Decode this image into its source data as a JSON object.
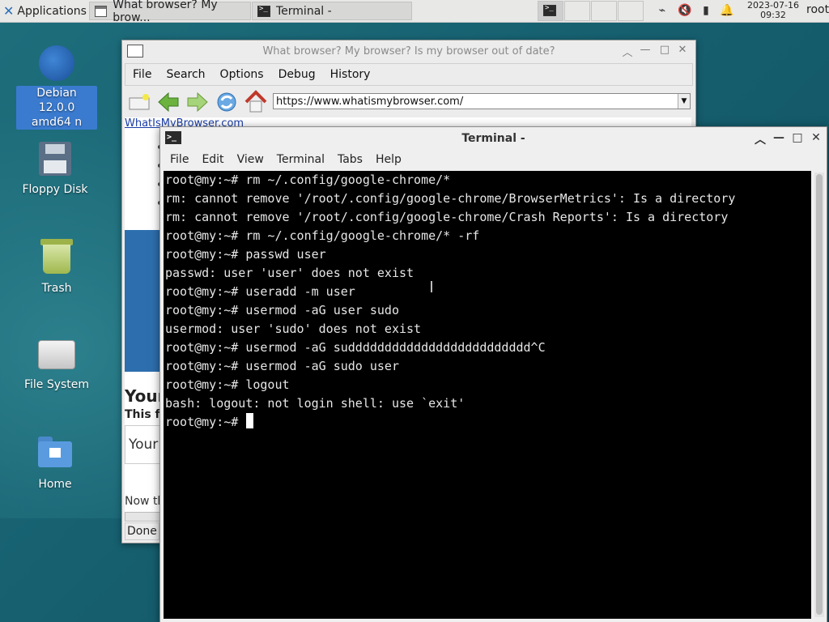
{
  "panel": {
    "applications_label": "Applications",
    "task1_label": "What browser? My brow...",
    "task2_label": "Terminal -",
    "clock_date": "2023-07-16",
    "clock_time": "09:32",
    "user": "root"
  },
  "desktop": {
    "icons": [
      {
        "label": "Debian 12.0.0 amd64 n"
      },
      {
        "label": "Floppy Disk"
      },
      {
        "label": "Trash"
      },
      {
        "label": "File System"
      },
      {
        "label": "Home"
      }
    ]
  },
  "browser": {
    "title": "What browser? My browser? Is my browser out of date?",
    "menu": [
      "File",
      "Search",
      "Options",
      "Debug",
      "History"
    ],
    "url": "https://www.whatismybrowser.com/",
    "link": "WhatIsMyBrowser.com",
    "heading": "Your",
    "subheading": "This fe",
    "box_text": "Your",
    "now_text": "Now th",
    "status": "Done"
  },
  "terminal": {
    "title": "Terminal -",
    "menu": [
      "File",
      "Edit",
      "View",
      "Terminal",
      "Tabs",
      "Help"
    ],
    "lines": [
      "root@my:~# rm ~/.config/google-chrome/*",
      "rm: cannot remove '/root/.config/google-chrome/BrowserMetrics': Is a directory",
      "rm: cannot remove '/root/.config/google-chrome/Crash Reports': Is a directory",
      "root@my:~# rm ~/.config/google-chrome/* -rf",
      "root@my:~# passwd user",
      "passwd: user 'user' does not exist",
      "root@my:~# useradd -m user",
      "root@my:~# usermod -aG user sudo",
      "usermod: user 'sudo' does not exist",
      "root@my:~# usermod -aG suddddddddddddddddddddddddd^C",
      "root@my:~# usermod -aG sudo user",
      "root@my:~# logout",
      "bash: logout: not login shell: use `exit'",
      "root@my:~# "
    ]
  }
}
